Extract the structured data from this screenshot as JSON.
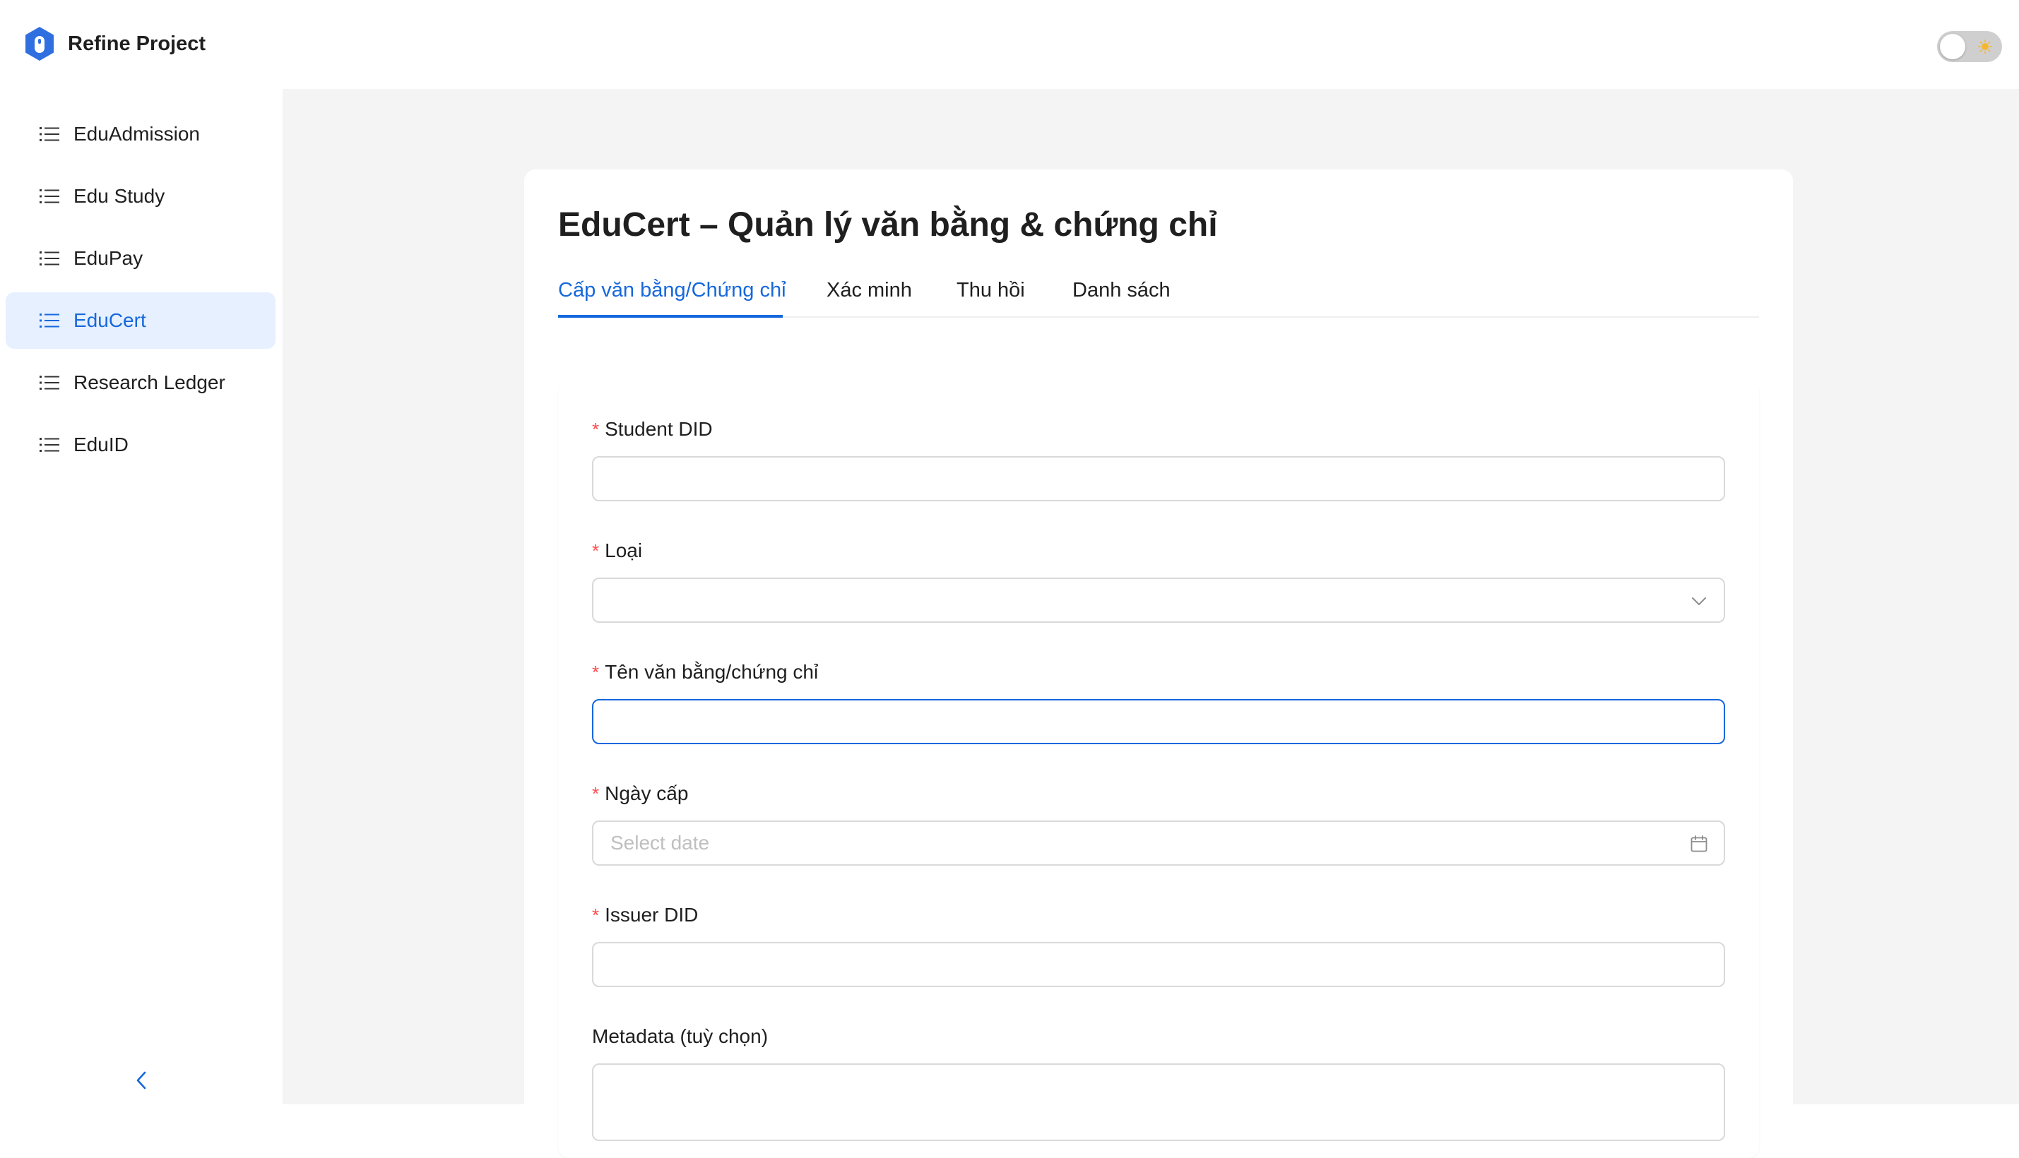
{
  "header": {
    "app_title": "Refine Project",
    "logo_icon": "refine-logo-icon",
    "theme_toggle": {
      "state": "light",
      "icon": "sun-icon"
    }
  },
  "sidebar": {
    "items": [
      {
        "label": "EduAdmission",
        "icon": "list-icon",
        "active": false
      },
      {
        "label": "Edu Study",
        "icon": "list-icon",
        "active": false
      },
      {
        "label": "EduPay",
        "icon": "list-icon",
        "active": false
      },
      {
        "label": "EduCert",
        "icon": "list-icon",
        "active": true
      },
      {
        "label": "Research Ledger",
        "icon": "list-icon",
        "active": false
      },
      {
        "label": "EduID",
        "icon": "list-icon",
        "active": false
      }
    ],
    "collapse_icon": "chevron-left-icon"
  },
  "main": {
    "title": "EduCert – Quản lý văn bằng & chứng chỉ",
    "tabs": [
      {
        "label": "Cấp văn bằng/Chứng chỉ",
        "active": true
      },
      {
        "label": "Xác minh",
        "active": false
      },
      {
        "label": "Thu hồi",
        "active": false
      },
      {
        "label": "Danh sách",
        "active": false
      }
    ],
    "form": {
      "fields": [
        {
          "label": "Student DID",
          "required": true,
          "type": "text",
          "value": ""
        },
        {
          "label": "Loại",
          "required": true,
          "type": "select",
          "value": "",
          "icon": "chevron-down-icon"
        },
        {
          "label": "Tên văn bằng/chứng chỉ",
          "required": true,
          "type": "text",
          "value": "",
          "focused": true
        },
        {
          "label": "Ngày cấp",
          "required": true,
          "type": "date",
          "value": "",
          "placeholder": "Select date",
          "icon": "calendar-icon"
        },
        {
          "label": "Issuer DID",
          "required": true,
          "type": "text",
          "value": ""
        },
        {
          "label": "Metadata (tuỳ chọn)",
          "required": false,
          "type": "textarea",
          "value": ""
        }
      ],
      "required_mark": "*"
    }
  },
  "colors": {
    "accent": "#1668dc",
    "active_nav_bg": "#e6f0ff",
    "required": "#ff4d4f",
    "main_bg": "#f4f4f4",
    "logo": "#2f6fe0"
  }
}
